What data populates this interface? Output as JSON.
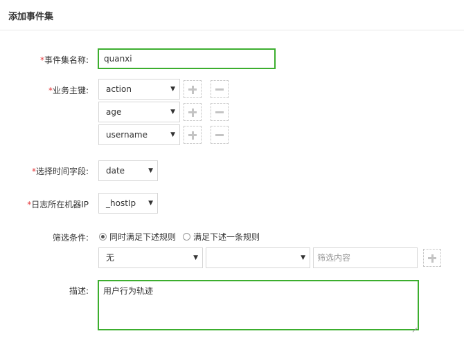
{
  "header": {
    "title": "添加事件集"
  },
  "form": {
    "required_mark": "*",
    "name": {
      "label": "事件集名称:",
      "value": "quanxi"
    },
    "keys": {
      "label": "业务主键:",
      "items": [
        {
          "value": "action"
        },
        {
          "value": "age"
        },
        {
          "value": "username"
        }
      ]
    },
    "time_field": {
      "label": "选择时间字段:",
      "value": "date"
    },
    "host_ip": {
      "label": "日志所在机器IP",
      "value": "_hostIp"
    },
    "filter": {
      "label": "筛选条件:",
      "option_all": "同时满足下述规则",
      "option_any": "满足下述一条规则",
      "field_value": "无",
      "operator_value": "",
      "content_placeholder": "筛选内容"
    },
    "description": {
      "label": "描述:",
      "value": "用户行为轨迹"
    }
  },
  "icons": {
    "caret": "▼",
    "add": "plus-icon",
    "remove": "minus-icon"
  },
  "colors": {
    "focus_border": "#3cae2e",
    "required": "#e4393c",
    "border": "#d6d6d6"
  }
}
